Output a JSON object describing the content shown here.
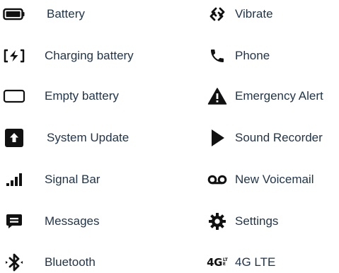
{
  "items_left": [
    {
      "label": "Battery",
      "icon": "battery-full-icon"
    },
    {
      "label": "Charging battery",
      "icon": "battery-charging-icon"
    },
    {
      "label": "Empty battery",
      "icon": "battery-empty-icon"
    },
    {
      "label": "System Update",
      "icon": "system-update-icon"
    },
    {
      "label": "Signal Bar",
      "icon": "signal-bar-icon"
    },
    {
      "label": "Messages",
      "icon": "message-icon"
    },
    {
      "label": "Bluetooth",
      "icon": "bluetooth-icon"
    }
  ],
  "items_right": [
    {
      "label": "Vibrate",
      "icon": "vibrate-icon"
    },
    {
      "label": "Phone",
      "icon": "phone-icon"
    },
    {
      "label": "Emergency Alert",
      "icon": "emergency-alert-icon"
    },
    {
      "label": "Sound Recorder",
      "icon": "play-triangle-icon"
    },
    {
      "label": "New Voicemail",
      "icon": "voicemail-icon"
    },
    {
      "label": "Settings",
      "icon": "gear-icon"
    },
    {
      "label": "4G LTE",
      "icon": "4g-lte-icon",
      "glyph_main": "4G",
      "glyph_sup_top": "LT",
      "glyph_sup_bottom": "E"
    }
  ],
  "colors": {
    "label_text": "#1f3349",
    "icon": "#111111"
  }
}
